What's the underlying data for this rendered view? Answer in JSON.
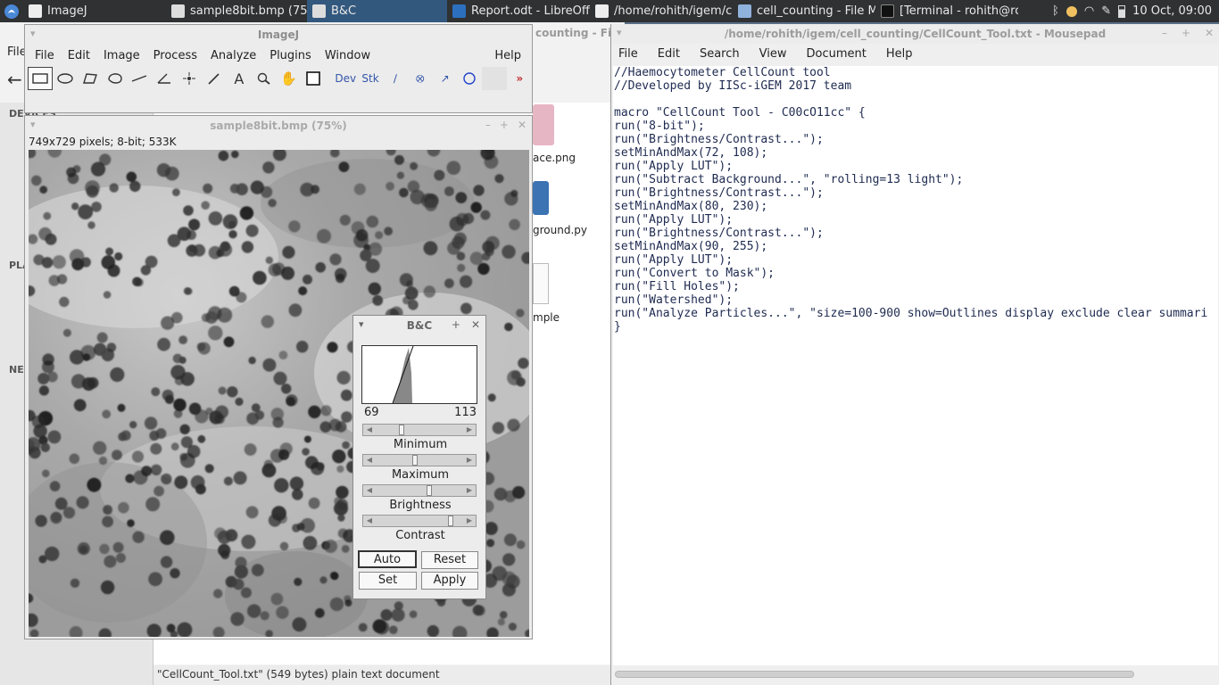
{
  "taskbar": {
    "tasks": [
      {
        "label": "ImageJ",
        "active": false
      },
      {
        "label": "sample8bit.bmp (75%)",
        "active": false
      },
      {
        "label": "B&C",
        "active": true
      },
      {
        "label": "Report.odt - LibreOffi...",
        "active": false
      },
      {
        "label": "/home/rohith/igem/c...",
        "active": false
      },
      {
        "label": "cell_counting - File M...",
        "active": false
      },
      {
        "label": "[Terminal - rohith@ro...",
        "active": false
      }
    ],
    "clock": "10 Oct, 09:00"
  },
  "file_manager": {
    "menu_first": "File",
    "title_fragment": "counting - Fil",
    "sidebar_headers": [
      "DEVICES",
      "PLA",
      "NE"
    ],
    "files": [
      "ace.png",
      "ground.py",
      "mple"
    ],
    "status": "\"CellCount_Tool.txt\" (549 bytes) plain text document"
  },
  "imagej": {
    "title": "ImageJ",
    "menu": [
      "File",
      "Edit",
      "Image",
      "Process",
      "Analyze",
      "Plugins",
      "Window",
      "Help"
    ],
    "tools": [
      "rectangle-icon",
      "oval-icon",
      "polygon-icon",
      "freehand-icon",
      "line-icon",
      "angle-icon",
      "point-icon",
      "wand-icon",
      "text-icon",
      "magnifier-icon",
      "hand-icon",
      "color-picker-icon"
    ],
    "tool_dev": "Dev",
    "tool_stk": "Stk"
  },
  "image_window": {
    "title": "sample8bit.bmp (75%)",
    "info": "749x729 pixels; 8-bit; 533K"
  },
  "bc": {
    "title": "B&C",
    "min_value": "69",
    "max_value": "113",
    "labels": {
      "minimum": "Minimum",
      "maximum": "Maximum",
      "brightness": "Brightness",
      "contrast": "Contrast"
    },
    "slider_levels": {
      "minimum": 0.28,
      "maximum": 0.45,
      "brightness": 0.62,
      "contrast": 0.88
    },
    "buttons": {
      "auto": "Auto",
      "reset": "Reset",
      "set": "Set",
      "apply": "Apply"
    }
  },
  "mousepad": {
    "title": "/home/rohith/igem/cell_counting/CellCount_Tool.txt - Mousepad",
    "menu": [
      "File",
      "Edit",
      "Search",
      "View",
      "Document",
      "Help"
    ],
    "lines": [
      "//Haemocytometer CellCount tool",
      "//Developed by IISc-iGEM 2017 team",
      "",
      "macro \"CellCount Tool - C00cO11cc\" {",
      "run(\"8-bit\");",
      "run(\"Brightness/Contrast...\");",
      "setMinAndMax(72, 108);",
      "run(\"Apply LUT\");",
      "run(\"Subtract Background...\", \"rolling=13 light\");",
      "run(\"Brightness/Contrast...\");",
      "setMinAndMax(80, 230);",
      "run(\"Apply LUT\");",
      "run(\"Brightness/Contrast...\");",
      "setMinAndMax(90, 255);",
      "run(\"Apply LUT\");",
      "run(\"Convert to Mask\");",
      "run(\"Fill Holes\");",
      "run(\"Watershed\");",
      "run(\"Analyze Particles...\", \"size=100-900 show=Outlines display exclude clear summari",
      "}"
    ]
  }
}
